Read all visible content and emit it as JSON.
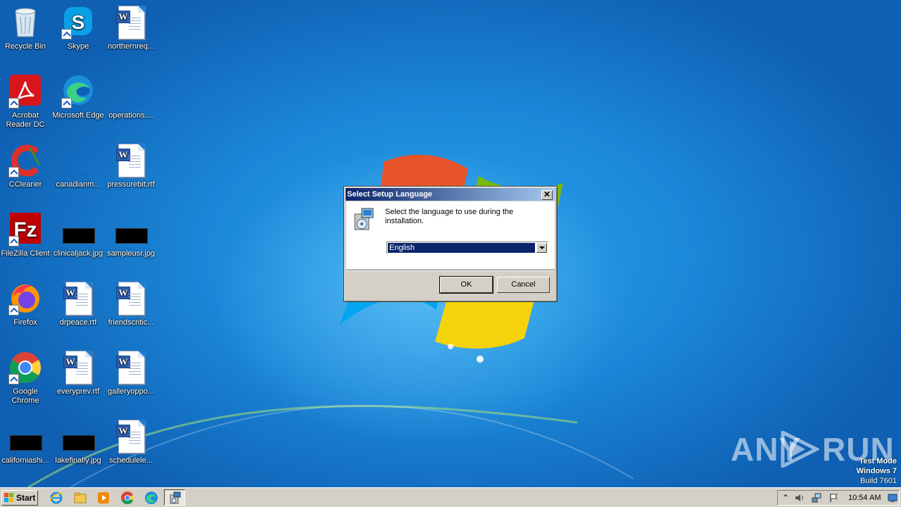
{
  "desktop": {
    "icons": [
      {
        "id": "recycle-bin",
        "label": "Recycle Bin"
      },
      {
        "id": "skype",
        "label": "Skype"
      },
      {
        "id": "northernreq",
        "label": "northernreq..."
      },
      {
        "id": "acrobat",
        "label": "Acrobat Reader DC"
      },
      {
        "id": "edge",
        "label": "Microsoft Edge"
      },
      {
        "id": "operations",
        "label": "operations...."
      },
      {
        "id": "ccleaner",
        "label": "CCleaner"
      },
      {
        "id": "canadianm",
        "label": "canadianm..."
      },
      {
        "id": "pressurebit",
        "label": "pressurebit.rtf"
      },
      {
        "id": "filezilla",
        "label": "FileZilla Client"
      },
      {
        "id": "clinicaljack",
        "label": "clinicaljack.jpg"
      },
      {
        "id": "sampleusr",
        "label": "sampleusr.jpg"
      },
      {
        "id": "firefox",
        "label": "Firefox"
      },
      {
        "id": "drpeace",
        "label": "drpeace.rtf"
      },
      {
        "id": "friendscritic",
        "label": "friendscritic..."
      },
      {
        "id": "chrome",
        "label": "Google Chrome"
      },
      {
        "id": "everyprev",
        "label": "everyprev.rtf"
      },
      {
        "id": "galleryoppo",
        "label": "galleryoppo..."
      },
      {
        "id": "californiashi",
        "label": "californiashi..."
      },
      {
        "id": "lakefinally",
        "label": "lakefinally.jpg"
      },
      {
        "id": "schedulele",
        "label": "schedulele..."
      }
    ]
  },
  "dialog": {
    "title": "Select Setup Language",
    "close_glyph": "✕",
    "prompt": "Select the language to use during the installation.",
    "language_selected": "English",
    "ok_label": "OK",
    "cancel_label": "Cancel"
  },
  "watermark": {
    "left": "ANY",
    "right": "RUN"
  },
  "system": {
    "test_mode_line1": "Test Mode",
    "test_mode_line2": "Windows 7",
    "test_mode_line3": "Build 7601"
  },
  "taskbar": {
    "start_label": "Start",
    "pinned": [
      "internet-explorer-icon",
      "file-explorer-icon",
      "media-player-icon",
      "chrome-icon",
      "edge-icon",
      "setup-app-icon"
    ],
    "clock": "10:54 AM"
  },
  "colors": {
    "desktop_blue": "#1b7ed3",
    "dialog_face": "#d4d0c8",
    "titlebar_start": "#0a246a",
    "titlebar_end": "#a6caf0",
    "selection": "#0a246a"
  }
}
